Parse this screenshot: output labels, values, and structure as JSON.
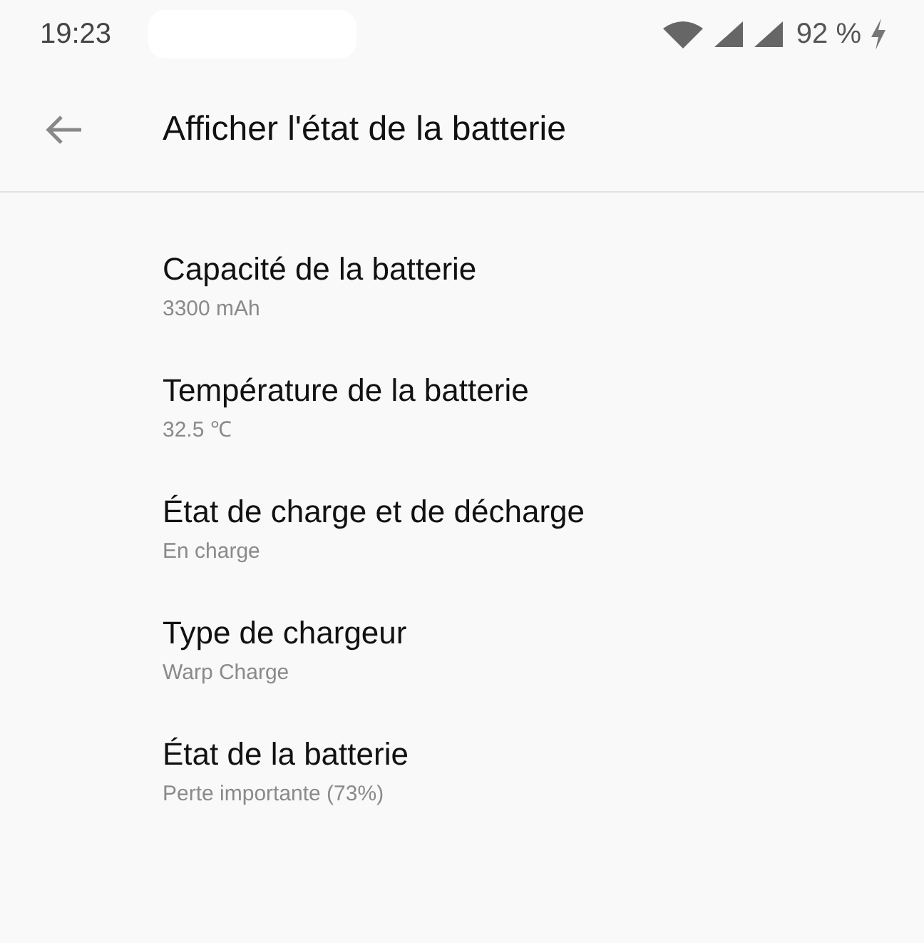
{
  "status_bar": {
    "time": "19:23",
    "battery": "92 %",
    "charging": true
  },
  "app_bar": {
    "title": "Afficher l'état de la batterie"
  },
  "items": [
    {
      "title": "Capacité de la batterie",
      "summary": "3300 mAh"
    },
    {
      "title": "Température de la batterie",
      "summary": "32.5 ℃"
    },
    {
      "title": "État de charge et de décharge",
      "summary": "En charge"
    },
    {
      "title": "Type de chargeur",
      "summary": "Warp Charge"
    },
    {
      "title": "État de la batterie",
      "summary": "Perte importante (73%)"
    }
  ]
}
